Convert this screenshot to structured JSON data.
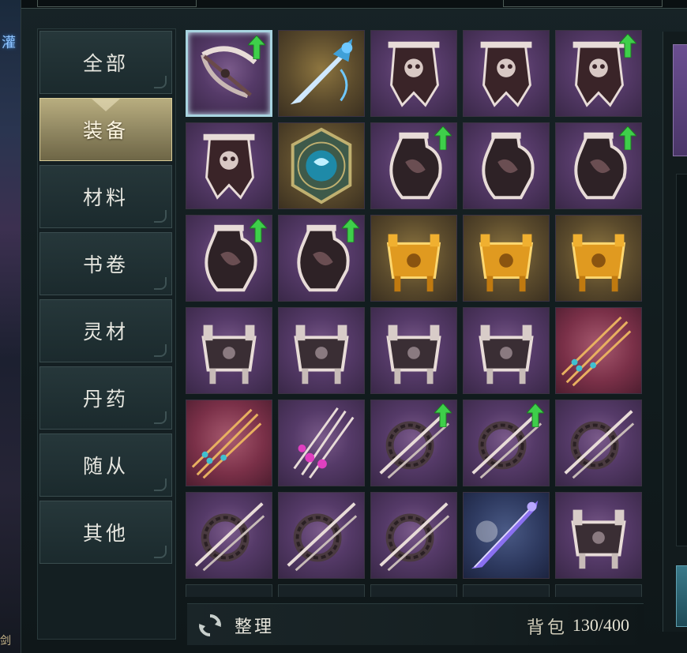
{
  "scene": {
    "left_sliver_text": "灌",
    "left_sliver_bottom_text": "剑"
  },
  "sidebar": {
    "tabs": [
      {
        "label": "全部",
        "active": false
      },
      {
        "label": "装备",
        "active": true
      },
      {
        "label": "材料",
        "active": false
      },
      {
        "label": "书卷",
        "active": false
      },
      {
        "label": "灵材",
        "active": false
      },
      {
        "label": "丹药",
        "active": false
      },
      {
        "label": "随从",
        "active": false
      },
      {
        "label": "其他",
        "active": false
      }
    ]
  },
  "grid": {
    "columns": 5,
    "items": [
      {
        "type": "crossbow",
        "rarity": "purple",
        "upgrade": true,
        "selected": true
      },
      {
        "type": "sword",
        "rarity": "gold",
        "upgrade": false
      },
      {
        "type": "banner",
        "rarity": "purple",
        "upgrade": false
      },
      {
        "type": "banner",
        "rarity": "purple",
        "upgrade": false
      },
      {
        "type": "banner",
        "rarity": "purple",
        "upgrade": true
      },
      {
        "type": "banner",
        "rarity": "purple",
        "upgrade": false
      },
      {
        "type": "shield",
        "rarity": "gold",
        "upgrade": false
      },
      {
        "type": "gourd",
        "rarity": "purple",
        "upgrade": true
      },
      {
        "type": "gourd",
        "rarity": "purple",
        "upgrade": false
      },
      {
        "type": "gourd",
        "rarity": "purple",
        "upgrade": true
      },
      {
        "type": "gourd",
        "rarity": "purple",
        "upgrade": true
      },
      {
        "type": "gourd",
        "rarity": "purple",
        "upgrade": true
      },
      {
        "type": "cauldron-gold",
        "rarity": "gold",
        "upgrade": false
      },
      {
        "type": "cauldron-gold",
        "rarity": "gold",
        "upgrade": false
      },
      {
        "type": "cauldron-gold",
        "rarity": "gold",
        "upgrade": false
      },
      {
        "type": "cauldron",
        "rarity": "purple",
        "upgrade": false
      },
      {
        "type": "cauldron",
        "rarity": "purple",
        "upgrade": false
      },
      {
        "type": "cauldron",
        "rarity": "purple",
        "upgrade": false
      },
      {
        "type": "cauldron",
        "rarity": "purple",
        "upgrade": false
      },
      {
        "type": "arrows",
        "rarity": "red",
        "upgrade": false
      },
      {
        "type": "arrows",
        "rarity": "red",
        "upgrade": false
      },
      {
        "type": "arrows-pink",
        "rarity": "purple",
        "upgrade": false
      },
      {
        "type": "ring-spear",
        "rarity": "purple",
        "upgrade": true
      },
      {
        "type": "ring-spear",
        "rarity": "purple",
        "upgrade": true
      },
      {
        "type": "ring-spear",
        "rarity": "purple",
        "upgrade": false
      },
      {
        "type": "ring-spear",
        "rarity": "purple",
        "upgrade": false
      },
      {
        "type": "ring-spear",
        "rarity": "purple",
        "upgrade": false
      },
      {
        "type": "ring-spear",
        "rarity": "purple",
        "upgrade": false
      },
      {
        "type": "sword-purple",
        "rarity": "blue",
        "upgrade": false
      },
      {
        "type": "cauldron",
        "rarity": "purple",
        "upgrade": false
      }
    ],
    "partial_row_slots": 5
  },
  "footer": {
    "sort_label": "整理",
    "bag_label": "背包",
    "bag_count": "130/400"
  },
  "colors": {
    "accent_gold": "#b8ad7f",
    "upgrade_green": "#3ecf4a",
    "rarity_purple": "#553a68",
    "rarity_gold": "#5a4a2c",
    "rarity_red": "#7a3048"
  }
}
